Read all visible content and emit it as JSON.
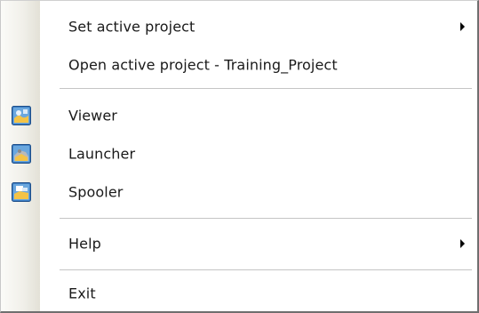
{
  "menu": {
    "items": [
      {
        "label": "Set active project",
        "submenu": true
      },
      {
        "label": "Open active project - Training_Project",
        "submenu": false
      },
      {
        "label": "Viewer",
        "icon": "viewer-icon"
      },
      {
        "label": "Launcher",
        "icon": "launcher-icon"
      },
      {
        "label": "Spooler",
        "icon": "spooler-icon"
      },
      {
        "label": "Help",
        "submenu": true
      },
      {
        "label": "Exit",
        "submenu": false
      }
    ]
  },
  "colors": {
    "gutter": "#f1f0ea",
    "separator": "#c5c5c5",
    "text": "#1a1a1a"
  }
}
